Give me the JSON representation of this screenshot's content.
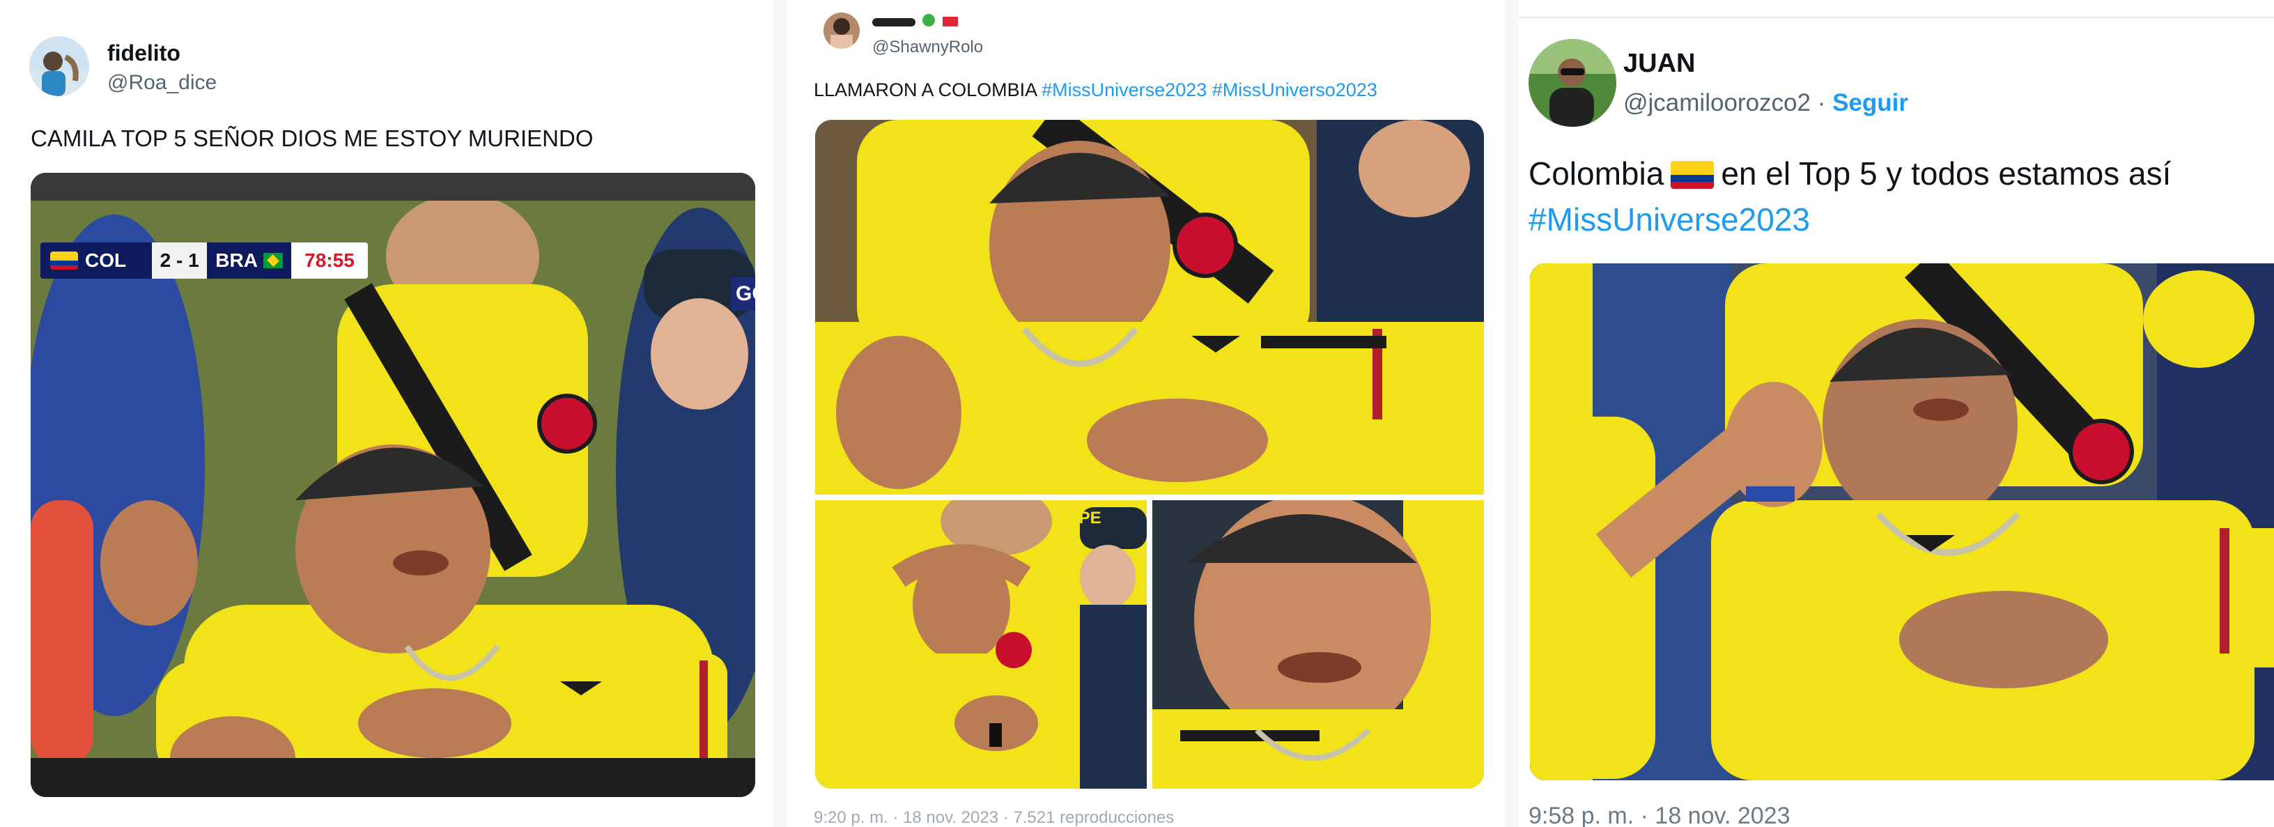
{
  "tweets": [
    {
      "name": "fidelito",
      "handle": "@Roa_dice",
      "text": "CAMILA TOP 5 SEÑOR DIOS ME ESTOY MURIENDO",
      "scoreboard": {
        "home": "COL",
        "score": "2 - 1",
        "away": "BRA",
        "clock": "78:55",
        "sponsor": "GO"
      }
    },
    {
      "handle": "@ShawnyRolo",
      "text_prefix": "LLAMARON A COLOMBIA",
      "hashtags": [
        "#MissUniverse2023",
        "#MissUniverso2023"
      ],
      "cap_text": "OPE",
      "footer": "9:20 p. m. · 18 nov. 2023 · 7.521 reproducciones"
    },
    {
      "name": "JUAN",
      "handle": "@jcamiloorozco2",
      "follow": "Seguir",
      "separator": "·",
      "text_before_flag": "Colombia",
      "text_after_flag": "en el Top 5 y todos estamos así",
      "hashtag": "#MissUniverse2023",
      "timestamp": "9:58 p. m. · 18 nov. 2023"
    }
  ],
  "colors": {
    "hashtag": "#1d9bf0",
    "jersey_yellow": "#f2e21a",
    "flag_yellow": "#fcd116",
    "flag_blue": "#003893",
    "flag_red": "#ce1126",
    "brazil_green": "#009c3b"
  }
}
